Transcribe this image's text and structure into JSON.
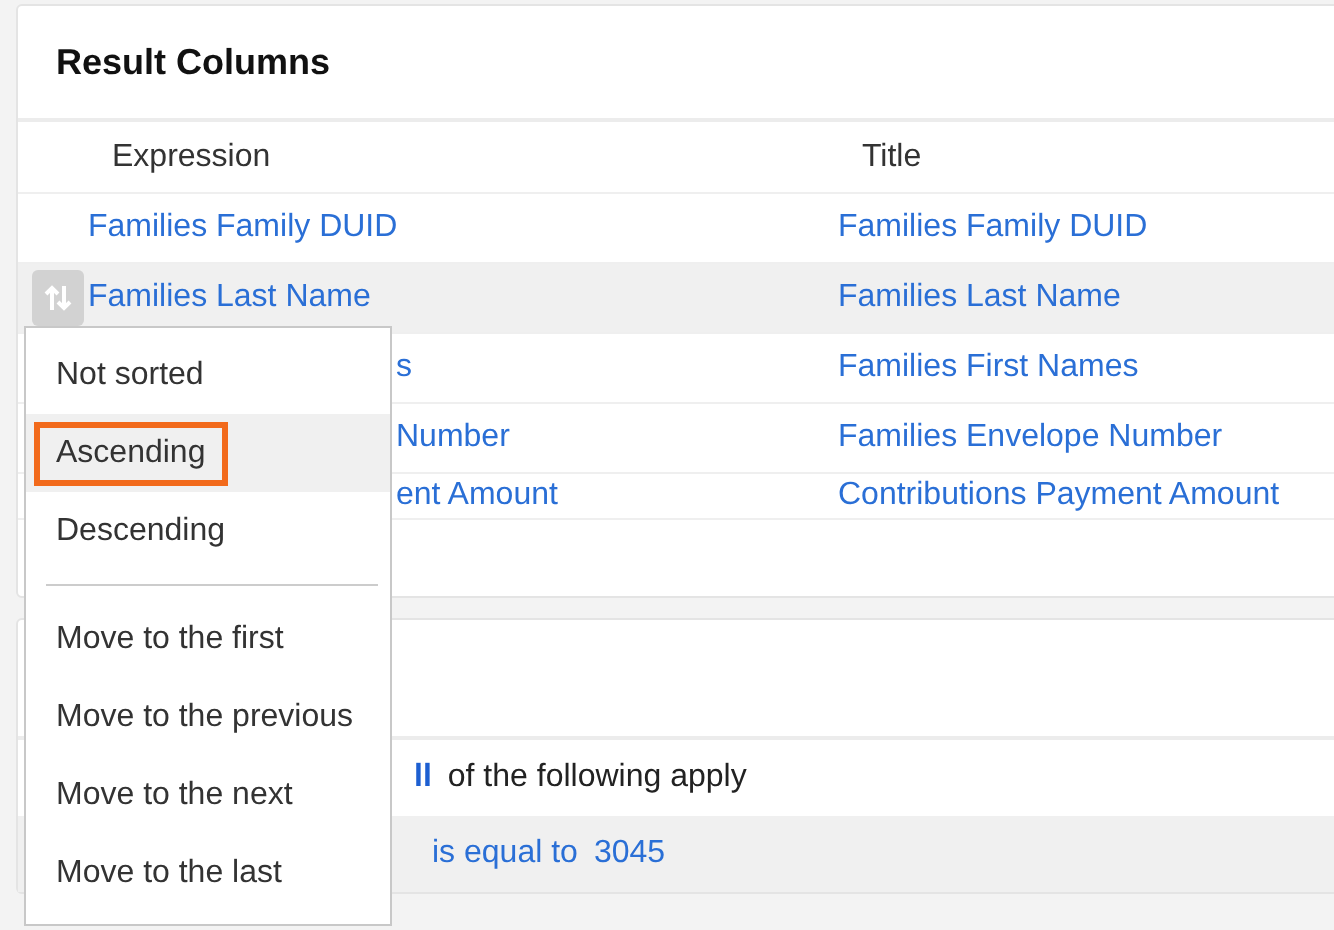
{
  "result_columns": {
    "title": "Result Columns",
    "columns": [
      "Expression",
      "Title"
    ],
    "rows": [
      {
        "expression": "Families Family DUID",
        "title": "Families Family DUID",
        "kind": "full",
        "selected": false
      },
      {
        "expression": "Families Last Name",
        "title": "Families Last Name",
        "kind": "full",
        "selected": true
      },
      {
        "expression": "s",
        "title": "Families First Names",
        "kind": "covered",
        "selected": false
      },
      {
        "expression": "Number",
        "title": "Families Envelope Number",
        "kind": "covered",
        "selected": false
      },
      {
        "expression": "ent Amount",
        "title": "Contributions Payment Amount",
        "kind": "covered",
        "selected": false
      }
    ]
  },
  "sort_menu": {
    "sort_options": [
      {
        "label": "Not sorted",
        "selected": false
      },
      {
        "label": "Ascending",
        "selected": true
      },
      {
        "label": "Descending",
        "selected": false
      }
    ],
    "move_options": [
      "Move to the first",
      "Move to the previous",
      "Move to the next",
      "Move to the last"
    ]
  },
  "filter": {
    "match_word": "ll",
    "match_text": "of the following apply",
    "condition": {
      "operator": "is equal to",
      "value": "3045"
    }
  }
}
